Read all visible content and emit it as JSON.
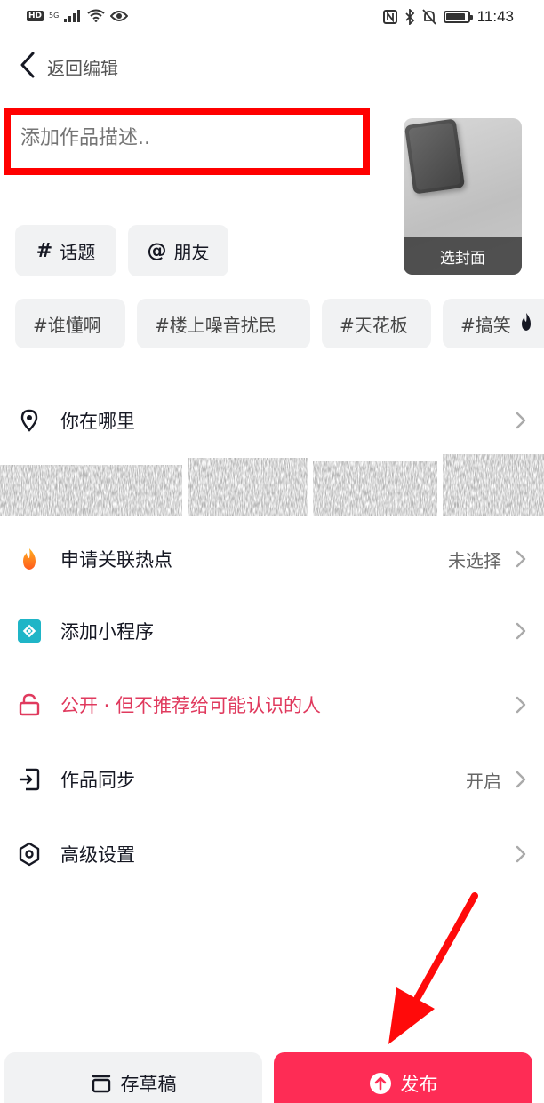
{
  "status_bar": {
    "network": "5G",
    "time": "11:43",
    "battery_level": 0.8
  },
  "nav": {
    "back_label": "返回编辑"
  },
  "description": {
    "placeholder": "添加作品描述.."
  },
  "cover": {
    "label": "选封面"
  },
  "chips": {
    "topic_symbol": "#",
    "topic_label": "话题",
    "friend_symbol": "@",
    "friend_label": "朋友"
  },
  "hashtags": [
    "#谁懂啊",
    "#楼上噪音扰民",
    "#天花板",
    "#搞笑"
  ],
  "settings": {
    "location": {
      "label": "你在哪里",
      "icon": "location-pin-icon"
    },
    "hotspot": {
      "label": "申请关联热点",
      "value": "未选择",
      "icon": "flame-icon"
    },
    "mini_program": {
      "label": "添加小程序",
      "icon": "mini-program-icon"
    },
    "visibility": {
      "label": "公开 · 但不推荐给可能认识的人",
      "icon": "unlock-icon",
      "color": "#e03a5e"
    },
    "sync": {
      "label": "作品同步",
      "value": "开启",
      "icon": "sync-icon"
    },
    "advanced": {
      "label": "高级设置",
      "icon": "hexagon-settings-icon"
    }
  },
  "actions": {
    "draft_label": "存草稿",
    "publish_label": "发布"
  },
  "colors": {
    "publish": "#fe2c55",
    "highlight_box": "#ff0000",
    "chip_bg": "#f1f2f3",
    "mini_program": "#1fb5c7"
  }
}
